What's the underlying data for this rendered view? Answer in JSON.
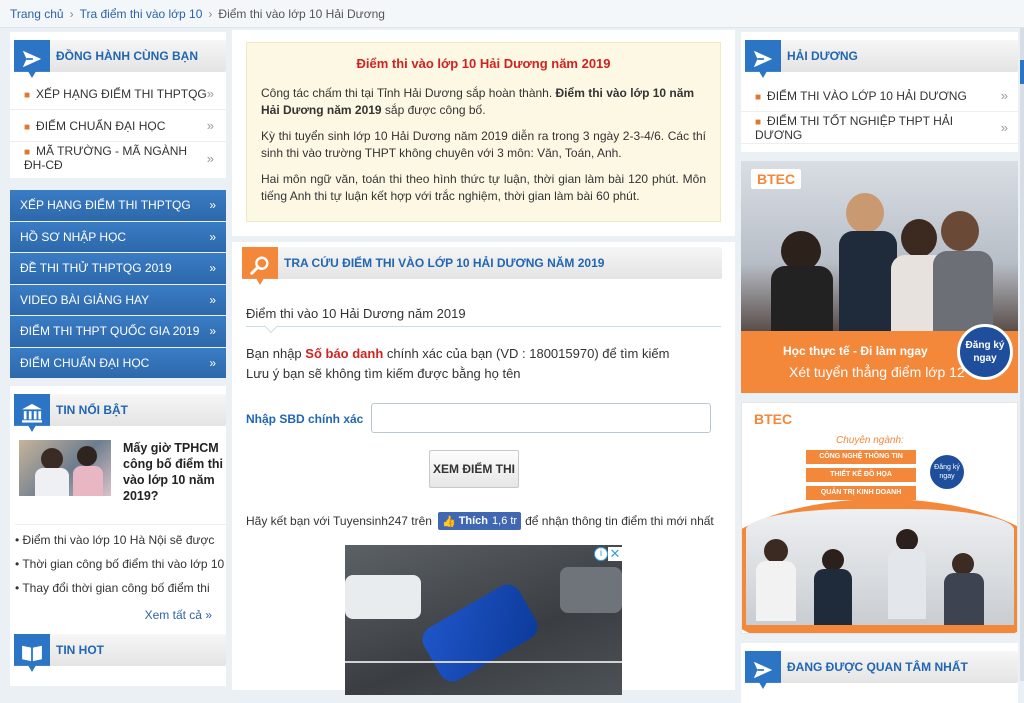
{
  "breadcrumb": {
    "home": "Trang chủ",
    "level2": "Tra điểm thi vào lớp 10",
    "level3": "Điểm thi vào lớp 10 Hải Dương"
  },
  "left": {
    "box1": {
      "title": "ĐỒNG HÀNH CÙNG BẠN",
      "items": [
        "XẾP HẠNG ĐIỂM THI THPTQG",
        "ĐIỂM CHUẨN ĐẠI HỌC",
        "MÃ TRƯỜNG - MÃ NGÀNH ĐH-CĐ"
      ]
    },
    "blue": [
      "XẾP HẠNG ĐIỂM THI THPTQG",
      "HỒ SƠ NHẬP HỌC",
      "ĐỀ THI THỬ THPTQG 2019",
      "VIDEO BÀI GIẢNG HAY",
      "ĐIỂM THI THPT QUỐC GIA 2019",
      "ĐIỂM CHUẨN ĐẠI HỌC"
    ],
    "box2": {
      "title": "TIN NỔI BẬT",
      "feature": "Mấy giờ TPHCM công bố điểm thi vào lớp 10 năm 2019?",
      "items": [
        "Điểm thi vào lớp 10 Hà Nội sẽ được",
        "Thời gian công bố điểm thi vào lớp 10",
        "Thay đổi thời gian công bố điểm thi"
      ],
      "more": "Xem tất cả"
    },
    "box3": {
      "title": "TIN HOT"
    }
  },
  "main": {
    "notice": {
      "title": "Điểm thi vào lớp 10 Hải Dương năm 2019",
      "p1a": "Công tác chấm thi tại Tỉnh Hải Dương sắp hoàn thành. ",
      "p1b": "Điểm thi vào lớp 10 năm Hải Dương năm 2019",
      "p1c": " sắp được công bố.",
      "p2": "Kỳ thi tuyển sinh lớp 10 Hải Dương năm 2019 diễn ra trong 3 ngày  2-3-4/6. Các thí sinh thi vào trường THPT không chuyên với 3 môn: Văn, Toán, Anh.",
      "p3": "Hai môn ngữ văn, toán thi theo hình thức tự luận, thời gian làm bài 120 phút. Môn tiếng Anh thi tự luận kết hợp với trắc nghiệm, thời gian làm bài 60 phút."
    },
    "search": {
      "title": "TRA CỨU ĐIỂM THI VÀO LỚP 10 HẢI DƯƠNG NĂM 2019",
      "subtitle": "Điểm thi vào 10 Hải Dương năm 2019",
      "line1a": "Bạn nhập ",
      "line1b": "Số báo danh",
      "line1c": " chính xác của bạn (VD : 180015970) để tìm kiếm",
      "line2": "Lưu ý bạn sẽ không tìm kiếm được bằng họ tên",
      "label": "Nhập SBD chính xác",
      "value": "",
      "button": "XEM ĐIỂM THI",
      "social_a": "Hãy kết bạn với Tuyensinh247 trên",
      "like": "Thích",
      "like_count": "1,6 tr",
      "social_b": "để nhận thông tin điểm thi mới nhất"
    }
  },
  "right": {
    "box1": {
      "title": "HẢI DƯƠNG",
      "items": [
        "ĐIỂM THI VÀO LỚP 10 HẢI DƯƠNG",
        "ĐIỂM THI TỐT NGHIỆP THPT HẢI DƯƠNG"
      ]
    },
    "ad1": {
      "brand": "BTEC",
      "slogan": "Học thực tế - Đi làm ngay",
      "headline": "Xét tuyển thẳng điểm lớp 12",
      "badge": "Đăng ký ngay"
    },
    "ad2": {
      "brand": "BTEC",
      "caption": "Chuyên ngành:",
      "majors": [
        "CÔNG NGHỆ THÔNG TIN",
        "THIẾT KẾ ĐỒ HỌA",
        "QUẢN TRỊ KINH DOANH"
      ],
      "badge": "Đăng ký ngay"
    },
    "box2": {
      "title": "ĐANG ĐƯỢC QUAN TÂM NHẤT"
    }
  },
  "colors": {
    "accent": "#2b75c4",
    "notice_bg": "#fdf8e4",
    "red": "#d0221f",
    "orange": "#f3873a"
  }
}
